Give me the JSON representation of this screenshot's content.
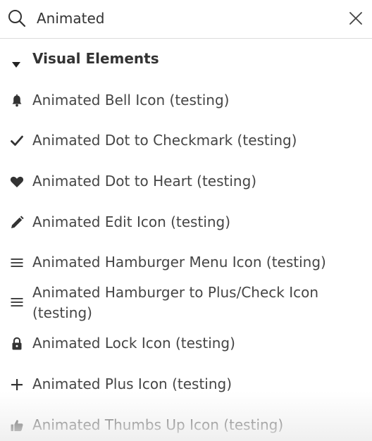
{
  "search": {
    "query": "Animated",
    "search_icon": "search-icon",
    "clear_icon": "close-icon"
  },
  "section": {
    "title": "Visual Elements",
    "toggle_icon": "caret-down-icon",
    "expanded": true
  },
  "results": [
    {
      "label": "Animated Bell Icon (testing)",
      "icon": "bell-icon"
    },
    {
      "label": "Animated Dot to Checkmark (testing)",
      "icon": "checkmark-icon"
    },
    {
      "label": "Animated Dot to Heart (testing)",
      "icon": "heart-icon"
    },
    {
      "label": "Animated Edit Icon (testing)",
      "icon": "pencil-icon"
    },
    {
      "label": "Animated Hamburger Menu Icon (testing)",
      "icon": "hamburger-icon"
    },
    {
      "label": "Animated Hamburger to Plus/Check Icon (testing)",
      "icon": "hamburger-icon"
    },
    {
      "label": "Animated Lock Icon (testing)",
      "icon": "lock-icon"
    },
    {
      "label": "Animated Plus Icon (testing)",
      "icon": "plus-icon"
    },
    {
      "label": "Animated Thumbs Up Icon (testing)",
      "icon": "thumbs-up-icon"
    }
  ]
}
